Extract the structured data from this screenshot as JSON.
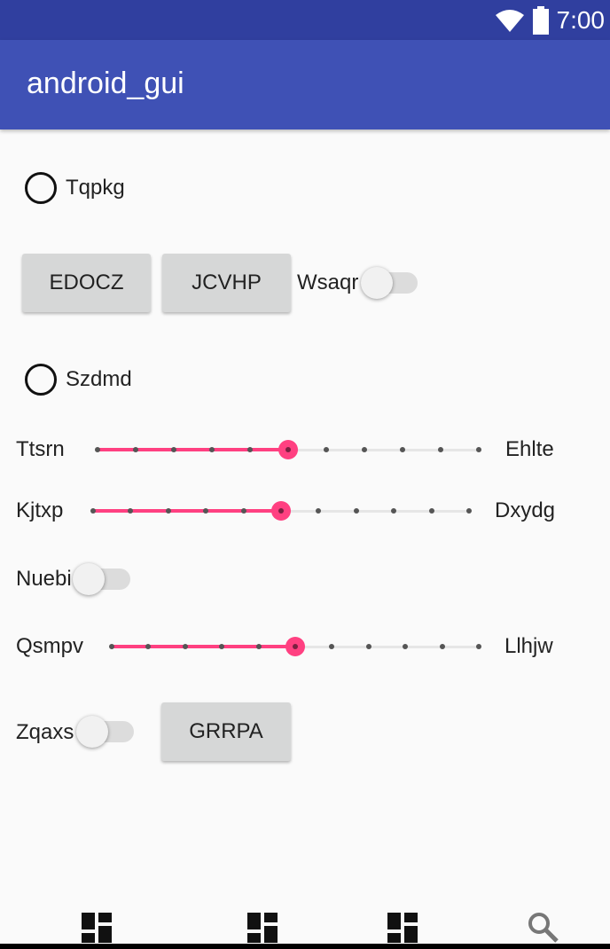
{
  "status_bar": {
    "time": "7:00",
    "icons": [
      "wifi-icon",
      "battery-icon"
    ]
  },
  "app_bar": {
    "title": "android_gui"
  },
  "radio_1": {
    "label": "Tqpkg",
    "checked": false
  },
  "buttons_row": {
    "btn_1": "EDOCZ",
    "btn_2": "JCVHP",
    "switch_label": "Wsaqr",
    "switch_on": false
  },
  "radio_2": {
    "label": "Szdmd",
    "checked": false
  },
  "slider_1": {
    "left_label": "Ttsrn",
    "right_label": "Ehlte",
    "value": 5,
    "max": 10
  },
  "slider_2": {
    "left_label": "Kjtxp",
    "right_label": "Dxydg",
    "value": 5,
    "max": 10
  },
  "switch_nuebi": {
    "label": "Nuebi",
    "on": false
  },
  "slider_3": {
    "left_label": "Qsmpv",
    "right_label": "Llhjw",
    "value": 5,
    "max": 10
  },
  "last_row": {
    "switch_label": "Zqaxs",
    "switch_on": false,
    "button": "GRRPA"
  },
  "bottom_nav": {
    "items": [
      {
        "icon": "dashboard-icon"
      },
      {
        "icon": "dashboard-icon"
      },
      {
        "icon": "dashboard-icon"
      },
      {
        "icon": "search-icon"
      }
    ]
  },
  "colors": {
    "status_bar": "#303f9f",
    "app_bar": "#3f51b5",
    "accent": "#ff4081",
    "button": "#d6d7d7",
    "background": "#fafafa"
  }
}
